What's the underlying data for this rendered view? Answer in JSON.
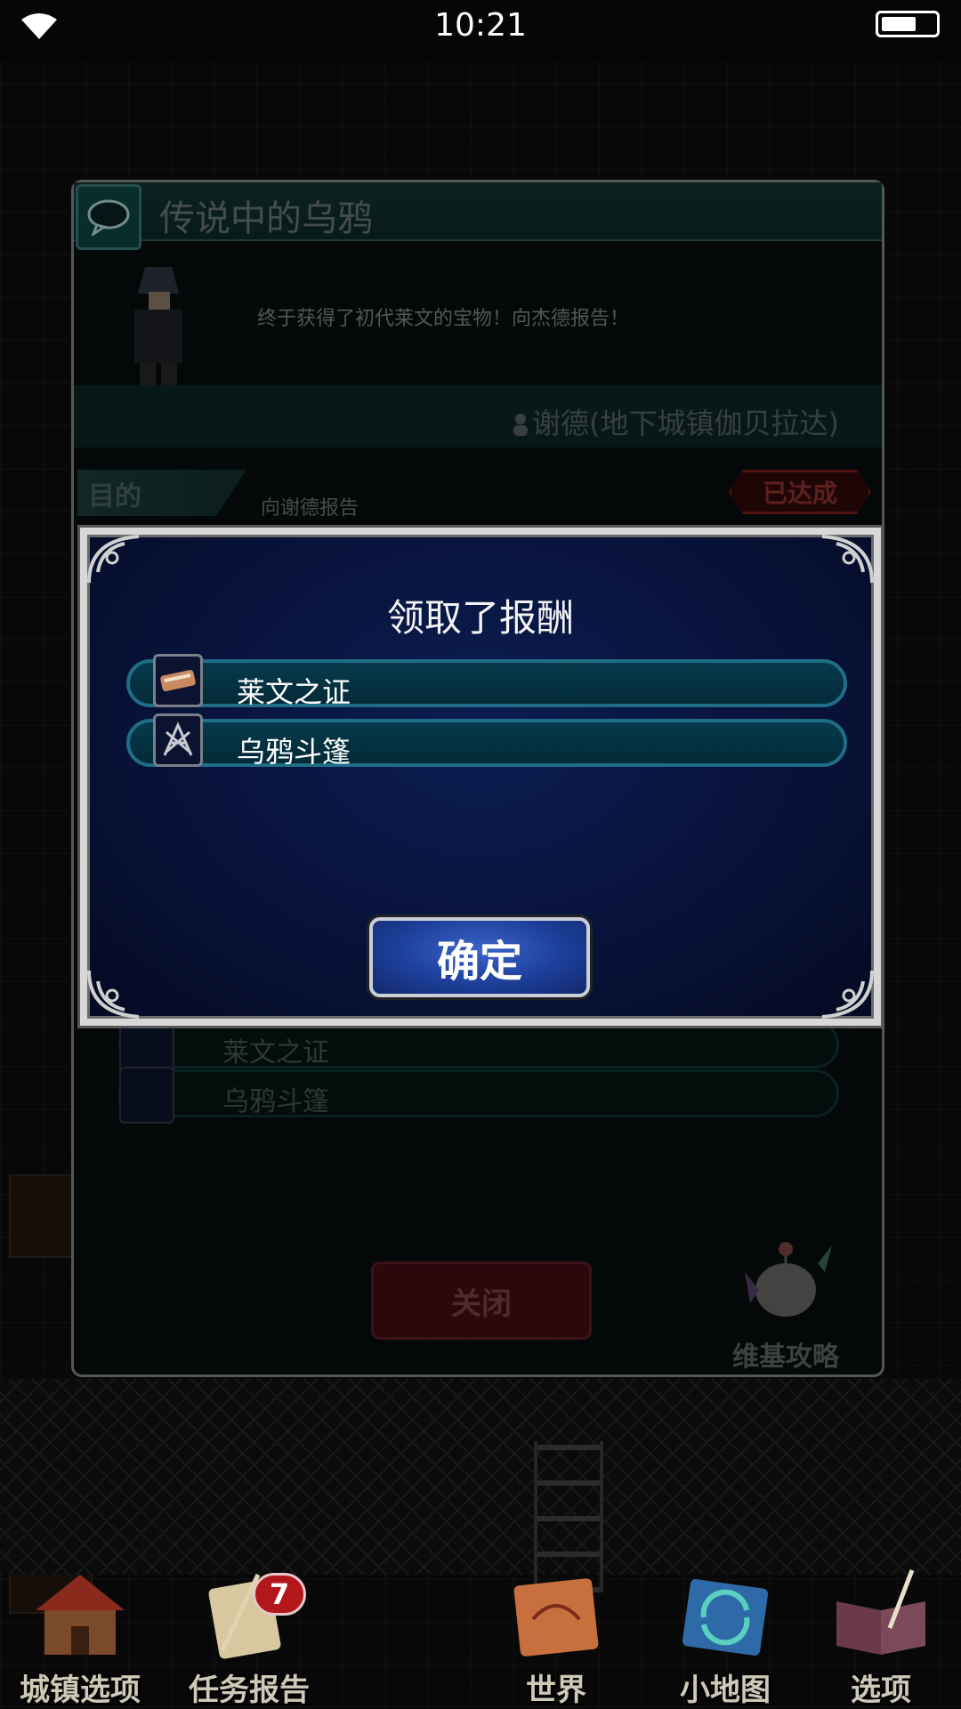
{
  "status_bar": {
    "time": "10:21"
  },
  "quest": {
    "title": "传说中的乌鸦",
    "description": "终于获得了初代莱文的宝物！向杰德报告！",
    "giver": "谢德(地下城镇伽贝拉达)",
    "objective_label": "目的",
    "objective_text": "向谢德报告",
    "status_badge": "已达成",
    "rewards": [
      "莱文之证",
      "乌鸦斗篷"
    ],
    "close_label": "关闭",
    "wiki_label": "维基攻略"
  },
  "modal": {
    "title": "领取了报酬",
    "items": [
      {
        "name": "莱文之证",
        "icon": "sword-proof-icon"
      },
      {
        "name": "乌鸦斗篷",
        "icon": "raven-cloak-icon"
      }
    ],
    "confirm_label": "确定"
  },
  "nav": {
    "items": [
      {
        "label": "城镇选项",
        "icon": "town-house-icon"
      },
      {
        "label": "任务报告",
        "icon": "quest-scroll-icon",
        "badge": "7"
      },
      {
        "label": "世界",
        "icon": "world-map-icon"
      },
      {
        "label": "小地图",
        "icon": "minimap-icon"
      },
      {
        "label": "选项",
        "icon": "options-book-icon"
      }
    ]
  }
}
